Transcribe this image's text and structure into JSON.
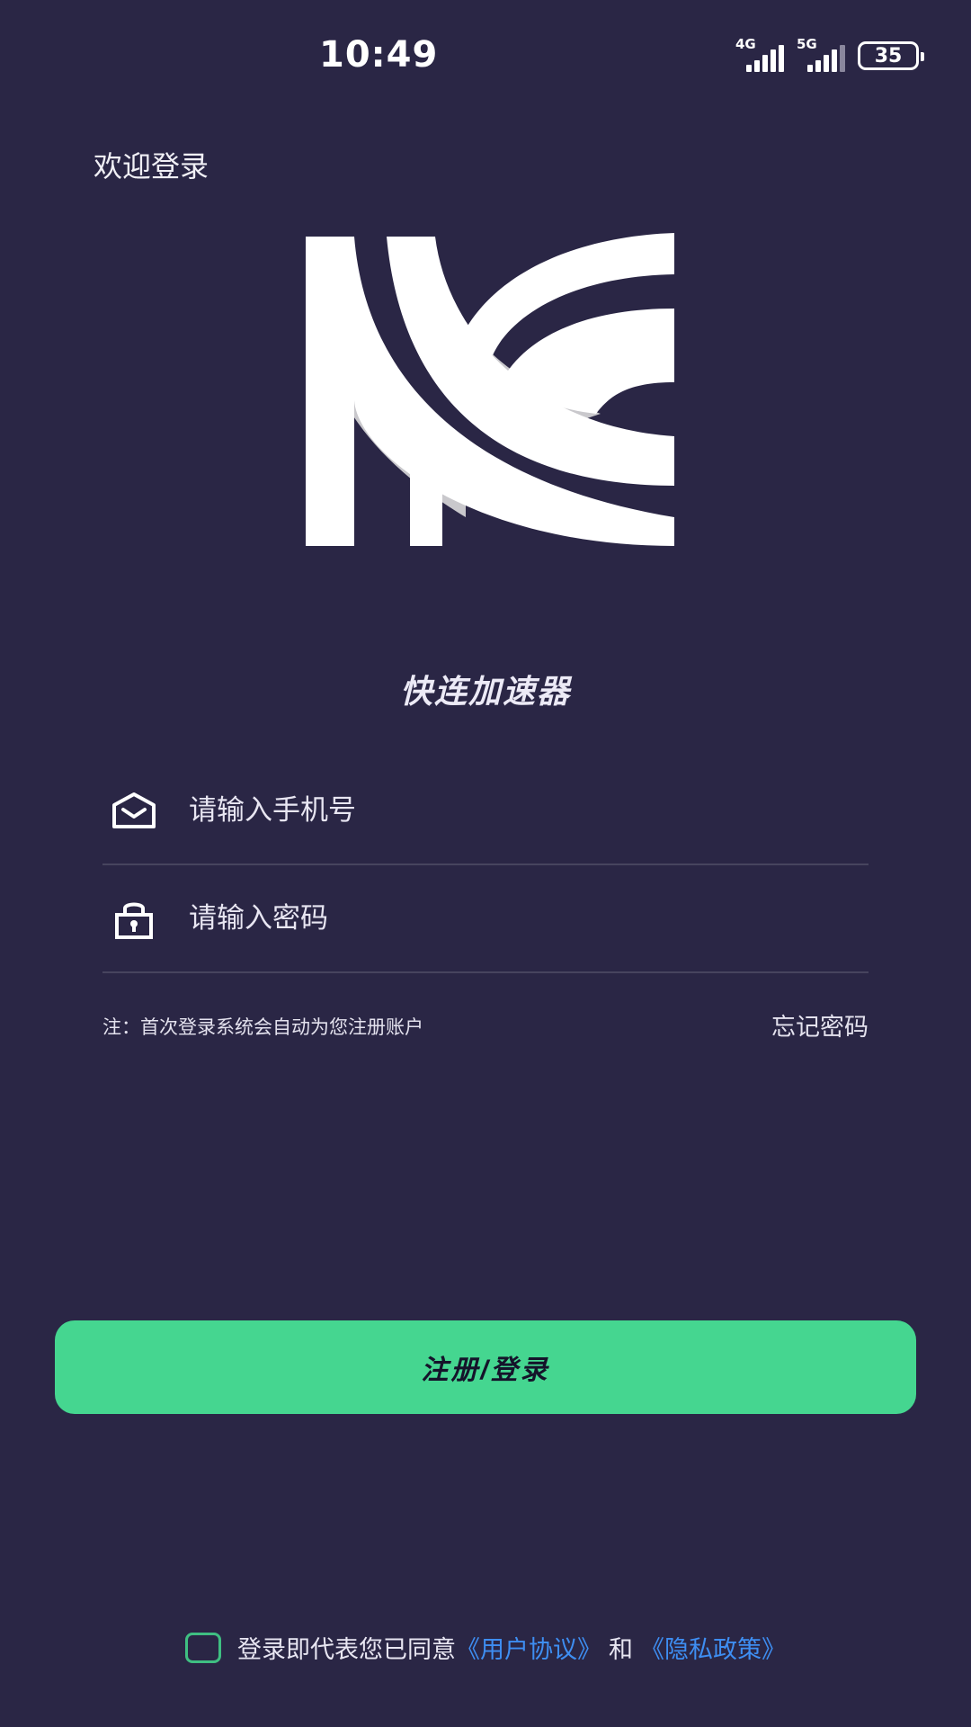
{
  "status_bar": {
    "time": "10:49",
    "network_1": "4G",
    "network_2": "5G",
    "battery": "35"
  },
  "header": {
    "welcome": "欢迎登录"
  },
  "brand": {
    "name": "快连加速器",
    "logo_icon": "kuailian-logo-icon"
  },
  "form": {
    "phone_placeholder": "请输入手机号",
    "phone_icon": "mail-icon",
    "password_placeholder": "请输入密码",
    "password_icon": "lock-icon",
    "note": "注：首次登录系统会自动为您注册账户",
    "forgot_password": "忘记密码",
    "submit_label": "注册/登录"
  },
  "agreement": {
    "prefix": "登录即代表您已同意",
    "user_agreement": "《用户协议》",
    "and": "和",
    "privacy_policy": "《隐私政策》",
    "checked": false
  },
  "colors": {
    "background": "#2a2645",
    "accent": "#45d690",
    "link": "#3e8ef2"
  }
}
